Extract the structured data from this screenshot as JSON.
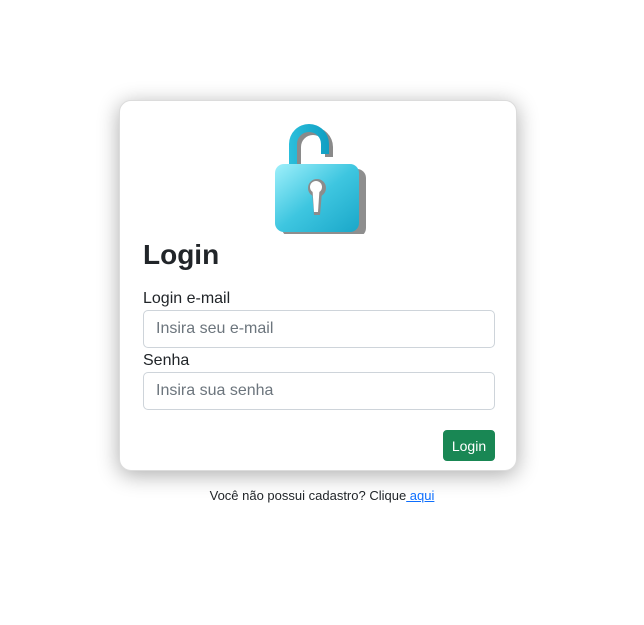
{
  "card": {
    "title": "Login",
    "email_label": "Login e-mail",
    "email_placeholder": "Insira seu e-mail",
    "password_label": "Senha",
    "password_placeholder": "Insira sua senha",
    "submit_label": "Login",
    "lock_icon": "open-padlock-icon"
  },
  "footer": {
    "prompt_text": "Você não possui cadastro? Clique",
    "link_text": " aqui"
  },
  "colors": {
    "primary_button": "#198754",
    "link": "#0d6efd",
    "lock_body": "#3ec6e0",
    "lock_shackle": "#16a9cc"
  }
}
